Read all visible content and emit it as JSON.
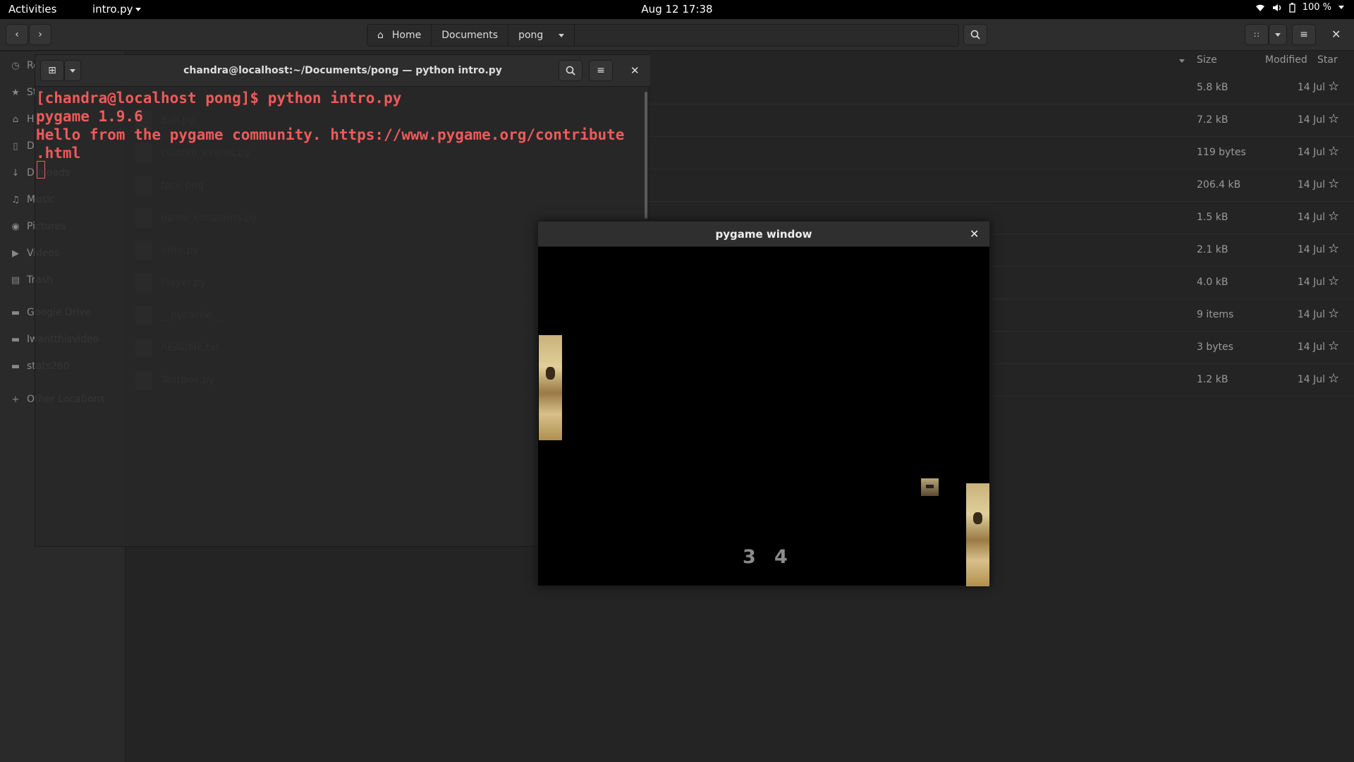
{
  "topbar": {
    "activities": "Activities",
    "app_menu": "intro.py",
    "clock": "Aug 12  17:38",
    "battery": "100 %"
  },
  "nautilus": {
    "path": [
      "Home",
      "Documents",
      "pong"
    ],
    "columns": {
      "size": "Size",
      "modified": "Modified",
      "star": "Star"
    },
    "sidebar": [
      {
        "label": "Recent",
        "visible": "Re",
        "icon": "clock-icon"
      },
      {
        "label": "Starred",
        "visible": "St",
        "icon": "star-icon"
      },
      {
        "label": "Home",
        "visible": "H",
        "icon": "home-icon"
      },
      {
        "label": "Documents",
        "visible": "D",
        "icon": "document-icon"
      },
      {
        "label": "Downloads",
        "visible": "D  nloads",
        "icon": "download-icon"
      },
      {
        "label": "Music",
        "visible": "Music",
        "icon": "music-icon"
      },
      {
        "label": "Pictures",
        "visible": "Pictures",
        "icon": "camera-icon"
      },
      {
        "label": "Videos",
        "visible": "Videos",
        "icon": "video-icon"
      },
      {
        "label": "Trash",
        "visible": "Trash",
        "icon": "trash-icon"
      },
      {
        "label": "Google Drive",
        "visible": "Google Drive",
        "icon": "folder-icon"
      },
      {
        "label": "Iwantthisvideo",
        "visible": "Iwantthisvideo",
        "icon": "folder-icon"
      },
      {
        "label": "stats260",
        "visible": "stats260",
        "icon": "folder-icon"
      },
      {
        "label": "Other Locations",
        "visible": "Other Locations",
        "icon": "plus-icon"
      }
    ],
    "files": [
      {
        "name": "",
        "size": "5.8 kB",
        "modified": "14 Jul"
      },
      {
        "name": "Ball.py",
        "size": "7.2 kB",
        "modified": "14 Jul"
      },
      {
        "name": "custom_events.py",
        "size": "119 bytes",
        "modified": "14 Jul"
      },
      {
        "name": "face.png",
        "size": "206.4 kB",
        "modified": "14 Jul"
      },
      {
        "name": "game_constants.py",
        "size": "1.5 kB",
        "modified": "14 Jul"
      },
      {
        "name": "intro.py",
        "size": "2.1 kB",
        "modified": "14 Jul"
      },
      {
        "name": "Player.py",
        "size": "4.0 kB",
        "modified": "14 Jul"
      },
      {
        "name": "__pycache__",
        "size": "9 items",
        "modified": "14 Jul"
      },
      {
        "name": "README.txt",
        "size": "3 bytes",
        "modified": "14 Jul"
      },
      {
        "name": "TextBox.py",
        "size": "1.2 kB",
        "modified": "14 Jul"
      }
    ]
  },
  "terminal": {
    "title": "chandra@localhost:~/Documents/pong — python intro.py",
    "lines": [
      "[chandra@localhost pong]$ python intro.py",
      "pygame 1.9.6",
      "Hello from the pygame community. https://www.pygame.org/contribute",
      ".html"
    ]
  },
  "pygame": {
    "title": "pygame window",
    "score_left": "3",
    "score_right": "4"
  },
  "colors": {
    "terminal_text": "#ef5a5a",
    "background": "#242424"
  }
}
